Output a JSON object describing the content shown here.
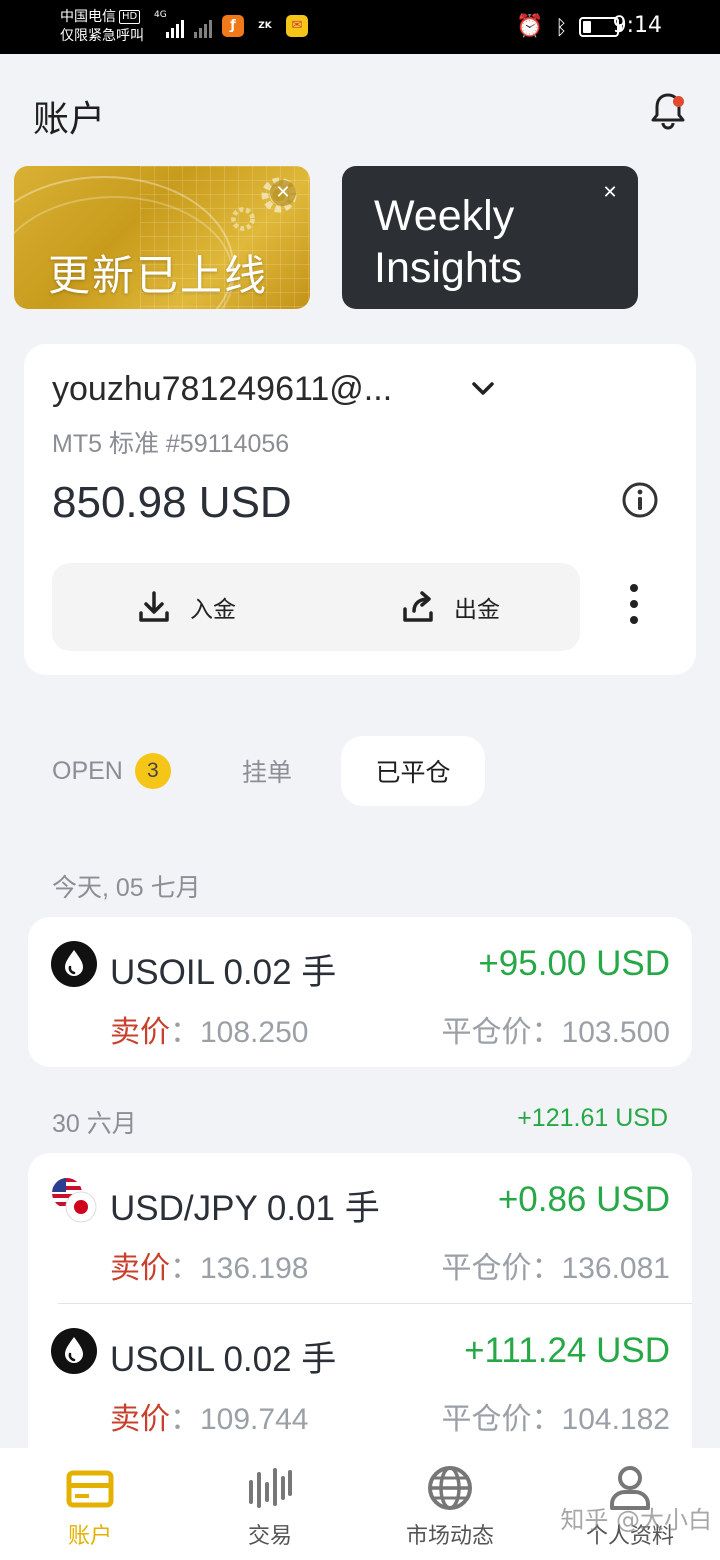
{
  "status_bar": {
    "carrier": "中国电信",
    "hd": "HD",
    "emergency": "仅限紧急呼叫",
    "network": "4G",
    "time": "9:14"
  },
  "header": {
    "title": "账户"
  },
  "banners": {
    "update_text": "更新已上线",
    "weekly_text_line1": "Weekly",
    "weekly_text_line2": "Insights",
    "close_glyph": "✕"
  },
  "account": {
    "email": "youzhu781249611@...",
    "subtitle": "MT5 标准 #59114056",
    "balance": "850.98 USD",
    "deposit_label": "入金",
    "withdraw_label": "出金"
  },
  "tabs": {
    "open_label": "OPEN",
    "open_count": "3",
    "pending_label": "挂单",
    "closed_label": "已平仓"
  },
  "groups": [
    {
      "date": "今天, 05 七月",
      "total": "",
      "trades": [
        {
          "symbol": "USOIL 0.02 手",
          "profit": "+95.00 USD",
          "sell_label": "卖价",
          "sell_price": "108.250",
          "close_label": "平仓价",
          "close_price": "103.500",
          "icon": "oil-drop-icon"
        }
      ]
    },
    {
      "date": "30 六月",
      "total": "+121.61 USD",
      "trades": [
        {
          "symbol": "USD/JPY 0.01 手",
          "profit": "+0.86 USD",
          "sell_label": "卖价",
          "sell_price": "136.198",
          "close_label": "平仓价",
          "close_price": "136.081",
          "icon": "usd-jpy-flags-icon"
        },
        {
          "symbol": "USOIL 0.02 手",
          "profit": "+111.24 USD",
          "sell_label": "卖价",
          "sell_price": "109.744",
          "close_label": "平仓价",
          "close_price": "104.182",
          "icon": "oil-drop-icon"
        }
      ]
    }
  ],
  "colon": "：",
  "bottom_nav": [
    {
      "label": "账户",
      "icon": "wallet-icon",
      "active": true
    },
    {
      "label": "交易",
      "icon": "candles-icon",
      "active": false
    },
    {
      "label": "市场动态",
      "icon": "globe-icon",
      "active": false
    },
    {
      "label": "个人资料",
      "icon": "person-icon",
      "active": false
    }
  ],
  "watermark": "知乎 @大小白",
  "colors": {
    "accent": "#f5c518",
    "profit": "#27a847",
    "sell": "#c8402b",
    "dark_banner": "#2c3035"
  }
}
